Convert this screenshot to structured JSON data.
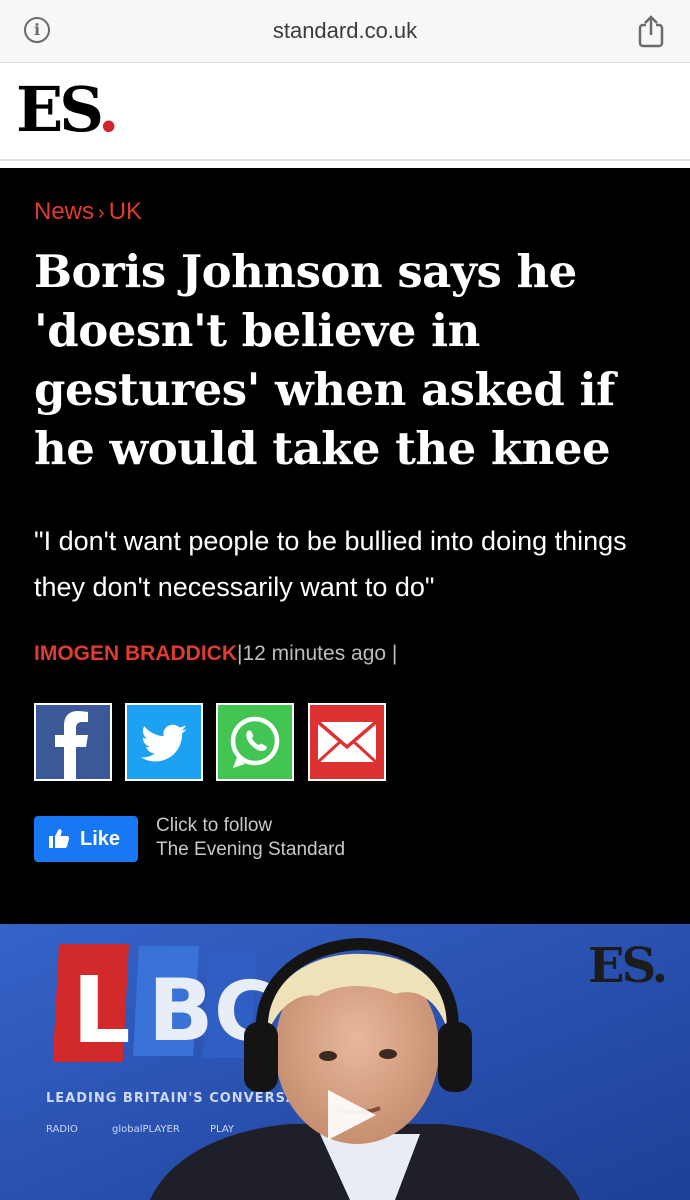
{
  "browser": {
    "url": "standard.co.uk"
  },
  "site": {
    "logo_text": "ES",
    "logo_dot": "."
  },
  "article": {
    "breadcrumb": {
      "section": "News",
      "separator": "›",
      "subsection": "UK"
    },
    "headline": "Boris Johnson says he 'doesn't believe in gestures' when asked if he would take the knee",
    "standfirst": "\"I don't want people to be bullied into doing things they don't necessarily want to do\"",
    "byline": {
      "author": "IMOGEN BRADDICK",
      "divider": "|",
      "time": "12 minutes ago",
      "trailing_divider": "|"
    }
  },
  "share": {
    "items": [
      "facebook-icon",
      "twitter-icon",
      "whatsapp-icon",
      "email-icon"
    ]
  },
  "follow": {
    "like_label": "Like",
    "line1": "Click to follow",
    "line2": "The Evening Standard"
  },
  "video": {
    "brand_letters": [
      "L",
      "B",
      "C"
    ],
    "tagline": "LEADING BRITAIN'S CONVERSATI",
    "platforms": [
      "RADIO",
      "globalPLAYER",
      "PLAY"
    ],
    "watermark": "ES."
  },
  "colors": {
    "accent_red": "#e03b30",
    "facebook": "#3b5998",
    "twitter": "#1da1f2",
    "whatsapp": "#43c553",
    "email": "#dc3232",
    "like_blue": "#1877f2"
  }
}
